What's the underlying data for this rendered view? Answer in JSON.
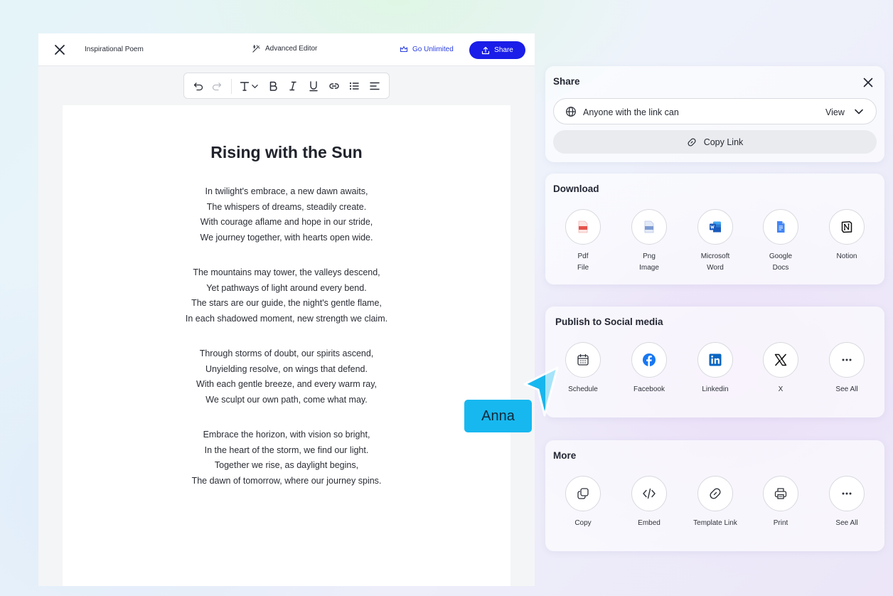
{
  "editor": {
    "doc_name": "Inspirational Poem",
    "advanced_editor": "Advanced Editor",
    "go_unlimited": "Go Unlimited",
    "share_label": "Share"
  },
  "poem": {
    "title": "Rising with the Sun",
    "stanzas": [
      [
        "In twilight's embrace, a new dawn awaits,",
        "The whispers of dreams, steadily create.",
        "With courage aflame and hope in our stride,",
        "We journey together, with hearts open wide."
      ],
      [
        "The mountains may tower, the valleys descend,",
        "Yet pathways of light around every bend.",
        "The stars are our guide, the night's gentle flame,",
        "In each shadowed moment, new strength we claim."
      ],
      [
        "Through storms of doubt, our spirits ascend,",
        "Unyielding resolve, on wings that defend.",
        "With each gentle breeze, and every warm ray,",
        "We sculpt our own path, come what may."
      ],
      [
        "Embrace the horizon, with vision so bright,",
        "In the heart of the storm, we find our light.",
        "Together we rise, as daylight begins,",
        "The dawn of tomorrow, where our journey spins."
      ]
    ]
  },
  "collaborator": {
    "name": "Anna",
    "color": "#17b8f0"
  },
  "share_panel": {
    "title": "Share",
    "access_text": "Anyone with the link can",
    "access_level": "View",
    "copy_link": "Copy Link"
  },
  "download": {
    "title": "Download",
    "items": [
      {
        "line1": "Pdf",
        "line2": "File",
        "icon": "pdf-file-icon"
      },
      {
        "line1": "Png",
        "line2": "Image",
        "icon": "png-image-icon"
      },
      {
        "line1": "Microsoft",
        "line2": "Word",
        "icon": "microsoft-word-icon"
      },
      {
        "line1": "Google",
        "line2": "Docs",
        "icon": "google-docs-icon"
      },
      {
        "line1": "Notion",
        "line2": "",
        "icon": "notion-icon"
      }
    ]
  },
  "social": {
    "title": "Publish to Social media",
    "items": [
      {
        "label": "Schedule",
        "icon": "calendar-icon"
      },
      {
        "label": "Facebook",
        "icon": "facebook-icon"
      },
      {
        "label": "Linkedin",
        "icon": "linkedin-icon"
      },
      {
        "label": "X",
        "icon": "x-logo-icon"
      },
      {
        "label": "See All",
        "icon": "more-dots-icon"
      }
    ]
  },
  "more": {
    "title": "More",
    "items": [
      {
        "label": "Copy",
        "icon": "copy-icon"
      },
      {
        "label": "Embed",
        "icon": "code-icon"
      },
      {
        "label": "Template Link",
        "icon": "link-icon"
      },
      {
        "label": "Print",
        "icon": "printer-icon"
      },
      {
        "label": "See All",
        "icon": "more-dots-icon"
      }
    ]
  },
  "colors": {
    "accent": "#1a1ee8",
    "facebook": "#1877f2",
    "linkedin": "#0a66c2",
    "word": "#185abd",
    "docs": "#4285f4",
    "pdf": "#e5534b"
  }
}
